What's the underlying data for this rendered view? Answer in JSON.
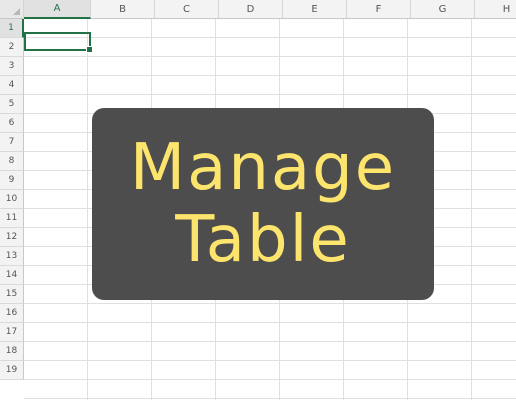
{
  "spreadsheet": {
    "columns": [
      "A",
      "B",
      "C",
      "D",
      "E",
      "F",
      "G",
      "H"
    ],
    "rows": [
      "1",
      "2",
      "3",
      "4",
      "5",
      "6",
      "7",
      "8",
      "9",
      "10",
      "11",
      "12",
      "13",
      "14",
      "15",
      "16",
      "17",
      "18",
      "19"
    ],
    "active_column": "A",
    "active_row": "1"
  },
  "overlay": {
    "line1": "Manage",
    "line2": "Table",
    "text_color": "#fde46d",
    "background_color": "#4d4d4d"
  },
  "colors": {
    "accent": "#217346"
  }
}
